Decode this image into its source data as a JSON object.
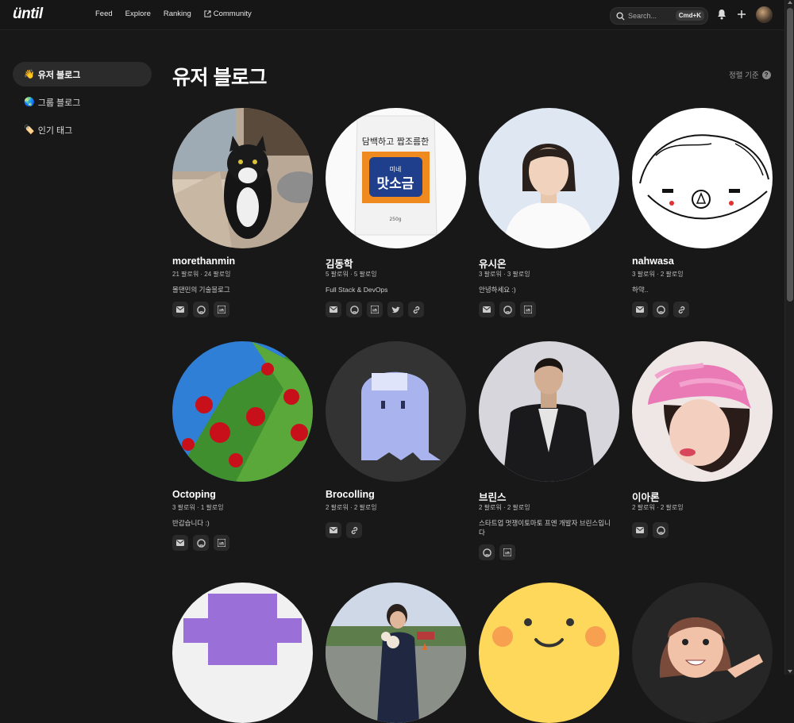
{
  "app": {
    "logo": "üntil"
  },
  "nav": {
    "feed": "Feed",
    "explore": "Explore",
    "ranking": "Ranking",
    "community": "Community"
  },
  "search": {
    "placeholder": "Search...",
    "shortcut": "Cmd+K"
  },
  "sidebar": {
    "items": [
      {
        "emoji": "👋",
        "label": "유저 블로그",
        "active": true
      },
      {
        "emoji": "🌏",
        "label": "그룹 블로그",
        "active": false
      },
      {
        "emoji": "🏷️",
        "label": "인기 태그",
        "active": false
      }
    ]
  },
  "page": {
    "title": "유저 블로그",
    "sort_label": "정렬 기준",
    "sort_help": "?"
  },
  "users": [
    {
      "name": "morethanmin",
      "follow": "21 팔로워 · 24 팔로잉",
      "bio": "몰댄민의 기술블로그",
      "links": [
        "mail",
        "github",
        "linkedin"
      ]
    },
    {
      "name": "김동학",
      "follow": "5 팔로워 · 5 팔로잉",
      "bio": "Full Stack & DevOps",
      "links": [
        "mail",
        "github",
        "linkedin",
        "twitter",
        "link"
      ]
    },
    {
      "name": "유시온",
      "follow": "3 팔로워 · 3 팔로잉",
      "bio": "안녕하세요 :)",
      "links": [
        "mail",
        "github",
        "linkedin"
      ]
    },
    {
      "name": "nahwasa",
      "follow": "3 팔로워 · 2 팔로잉",
      "bio": "하약..",
      "links": [
        "mail",
        "github",
        "link"
      ]
    },
    {
      "name": "Octoping",
      "follow": "3 팔로워 · 1 팔로잉",
      "bio": "반갑습니다 :)",
      "links": [
        "mail",
        "github",
        "linkedin"
      ]
    },
    {
      "name": "Brocolling",
      "follow": "2 팔로워 · 2 팔로잉",
      "bio": "",
      "links": [
        "mail",
        "link"
      ]
    },
    {
      "name": "브린스",
      "follow": "2 팔로워 · 2 팔로잉",
      "bio": "스타트업 멋쟁이토마토 프엔 개발자 브린스입니다",
      "links": [
        "github",
        "linkedin"
      ]
    },
    {
      "name": "이아론",
      "follow": "2 팔로워 · 2 팔로잉",
      "bio": "",
      "links": [
        "mail",
        "github"
      ]
    },
    {
      "name": "",
      "follow": "",
      "bio": "",
      "links": []
    },
    {
      "name": "",
      "follow": "",
      "bio": "",
      "links": []
    },
    {
      "name": "",
      "follow": "",
      "bio": "",
      "links": []
    },
    {
      "name": "",
      "follow": "",
      "bio": "",
      "links": []
    }
  ],
  "avatar_art": {
    "bag_tagline": "담백하고 짭조름한",
    "bag_brand": "미네",
    "bag_product": "맛소금",
    "bag_weight": "250g"
  },
  "colors": {
    "bg": "#181818",
    "card_link_bg": "#2a2a2a",
    "active_sidebar": "#2b2b2b"
  }
}
